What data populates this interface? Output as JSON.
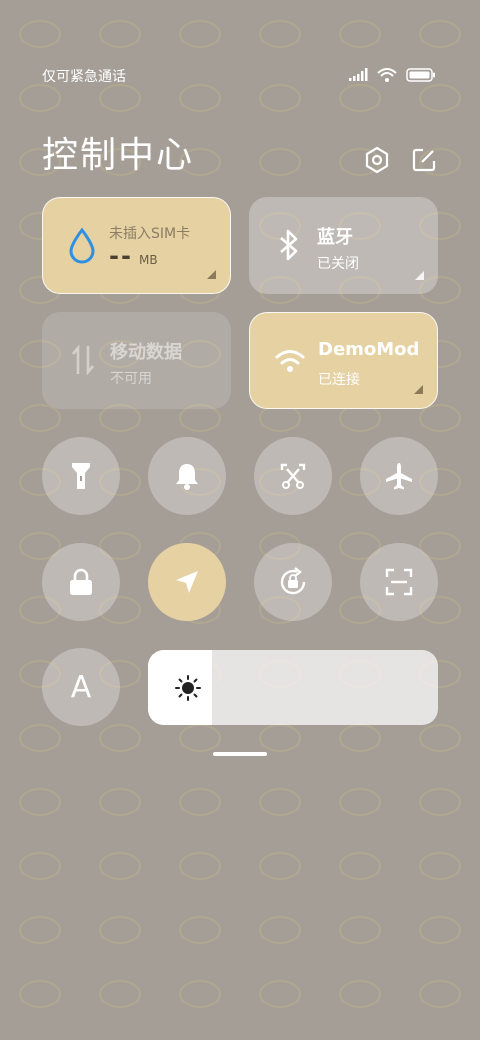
{
  "status_bar": {
    "carrier_text": "仅可紧急通话",
    "icons": [
      "signal-icon",
      "wifi-icon",
      "battery-icon"
    ]
  },
  "header": {
    "title": "控制中心",
    "icons": [
      "settings-hexagon-icon",
      "edit-icon"
    ]
  },
  "tiles": {
    "data_usage": {
      "label": "未插入SIM卡",
      "value": "--",
      "unit": "MB",
      "icon": "water-drop-icon",
      "state": "active"
    },
    "bluetooth": {
      "label": "蓝牙",
      "status": "已关闭",
      "icon": "bluetooth-icon",
      "state": "inactive"
    },
    "mobile_data": {
      "label": "移动数据",
      "status": "不可用",
      "icon": "data-arrows-icon",
      "state": "disabled"
    },
    "wifi": {
      "label": "DemoMode",
      "status": "已连接",
      "icon": "wifi-icon",
      "state": "active"
    }
  },
  "toggles_row1": [
    {
      "name": "flashlight-toggle",
      "icon": "flashlight-icon",
      "state": "off"
    },
    {
      "name": "ringer-toggle",
      "icon": "bell-icon",
      "state": "off"
    },
    {
      "name": "screenshot-toggle",
      "icon": "scissors-icon",
      "state": "off"
    },
    {
      "name": "airplane-toggle",
      "icon": "airplane-icon",
      "state": "off"
    }
  ],
  "toggles_row2": [
    {
      "name": "lock-toggle",
      "icon": "lock-icon",
      "state": "off"
    },
    {
      "name": "location-toggle",
      "icon": "location-arrow-icon",
      "state": "on"
    },
    {
      "name": "rotation-lock-toggle",
      "icon": "rotation-lock-icon",
      "state": "off"
    },
    {
      "name": "scanner-toggle",
      "icon": "scan-icon",
      "state": "off"
    }
  ],
  "auto_brightness": {
    "label": "A",
    "icon": "auto-brightness-icon"
  },
  "brightness": {
    "icon": "sun-icon",
    "level": 0.22
  },
  "colors": {
    "accent": "#e8d4a2",
    "background": "#a59e97",
    "tile_inactive": "rgba(255,255,255,0.28)"
  }
}
